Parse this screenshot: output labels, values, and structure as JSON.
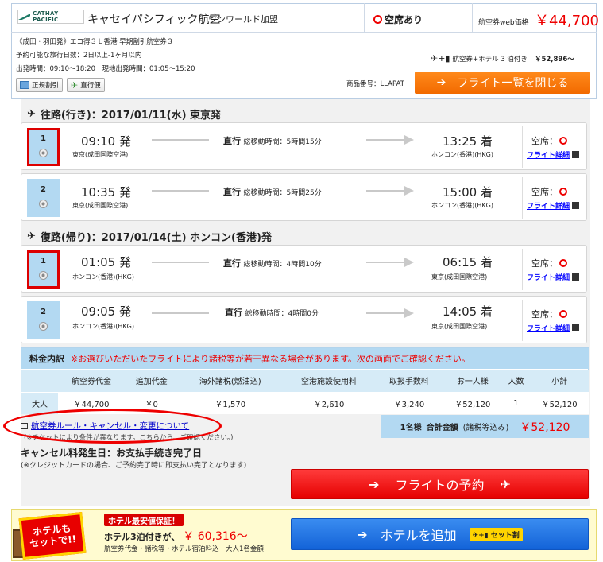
{
  "header": {
    "logo_text": "CATHAY PACIFIC",
    "airline": "キャセイパシフィック航空",
    "alliance": "ワンワールド加盟",
    "availability": "空席あり",
    "webprice_label": "航空券web価格",
    "webprice": "￥44,700",
    "info1": "《成田・羽田発》エコ得３Ｌ香港 早期割引航空券３",
    "info2": "予約可能な旅行日数：2日以上-1ヶ月以内",
    "info3": "出発時間：09:10〜18:20　現地出発時間：01:05〜15:20",
    "tag1": "正規割引",
    "tag2": "直行便",
    "plan": "航空券+ホテル 3 泊付き",
    "plan_price": "￥52,896〜",
    "product_code": "商品番号：LLAPAT",
    "close_btn": "フライト一覧を閉じる"
  },
  "outbound": {
    "title": "往路(行き)：2017/01/11(水) 東京発",
    "flights": [
      {
        "num": "1",
        "dep": "09:10 発",
        "dep_ap": "東京(成田国際空港)",
        "type": "直行",
        "dur_label": "総移動時間：",
        "dur": "5時間15分",
        "arr": "13:25 着",
        "arr_ap": "ホンコン(香港)(HKG)",
        "seat": "空席：",
        "detail": "フライト詳細"
      },
      {
        "num": "2",
        "dep": "10:35 発",
        "dep_ap": "東京(成田国際空港)",
        "type": "直行",
        "dur_label": "総移動時間：",
        "dur": "5時間25分",
        "arr": "15:00 着",
        "arr_ap": "ホンコン(香港)(HKG)",
        "seat": "空席：",
        "detail": "フライト詳細"
      }
    ]
  },
  "inbound": {
    "title": "復路(帰り)：2017/01/14(土) ホンコン(香港)発",
    "flights": [
      {
        "num": "1",
        "dep": "01:05 発",
        "dep_ap": "ホンコン(香港)(HKG)",
        "type": "直行",
        "dur_label": "総移動時間：",
        "dur": "4時間10分",
        "arr": "06:15 着",
        "arr_ap": "東京(成田国際空港)",
        "seat": "空席：",
        "detail": "フライト詳細"
      },
      {
        "num": "2",
        "dep": "09:05 発",
        "dep_ap": "ホンコン(香港)(HKG)",
        "type": "直行",
        "dur_label": "総移動時間：",
        "dur": "4時間0分",
        "arr": "14:05 着",
        "arr_ap": "東京(成田国際空港)",
        "seat": "空席：",
        "detail": "フライト詳細"
      }
    ]
  },
  "fee": {
    "title": "料金内訳",
    "notice": "※お選びいただいたフライトにより諸税等が若干異なる場合があります。次の画面でご確認ください。",
    "headers": [
      "",
      "航空券代金",
      "追加代金",
      "海外諸税(燃油込)",
      "空港施設使用料",
      "取扱手数料",
      "お一人様",
      "人数",
      "小計"
    ],
    "row": [
      "大人",
      "￥44,700",
      "￥0",
      "￥1,570",
      "￥2,610",
      "￥3,240",
      "￥52,120",
      "1",
      "￥52,120"
    ]
  },
  "total": {
    "people": "1名様",
    "label": "合計金額",
    "sub": "(諸税等込み)",
    "amount": "￥52,120"
  },
  "rules_link": "航空券ルール・キャンセル・変更について",
  "rules_note": "(※チケットにより条件が異なります。こちらから、ご確認ください。)",
  "cancel_title": "キャンセル料発生日：お支払手続き完了日",
  "cancel_note": "(※クレジットカードの場合、ご予約完了時に即支払い完了となります)",
  "book_btn": "フライトの予約",
  "promo": {
    "badge1": "ホテルも",
    "badge2": "セットで!!",
    "guarantee": "ホテル最安値保証！",
    "price_label": "ホテル3泊付きが、",
    "price": "￥ 60,316〜",
    "note": "航空券代金・諸税等・ホテル宿泊料込　大人1名金額",
    "add_btn": "ホテルを追加",
    "set_label": "セット割"
  },
  "colors": {
    "accent_orange": "#f26a00",
    "red": "#e50000",
    "blue": "#1363d8",
    "light_blue": "#b3d9f2"
  }
}
